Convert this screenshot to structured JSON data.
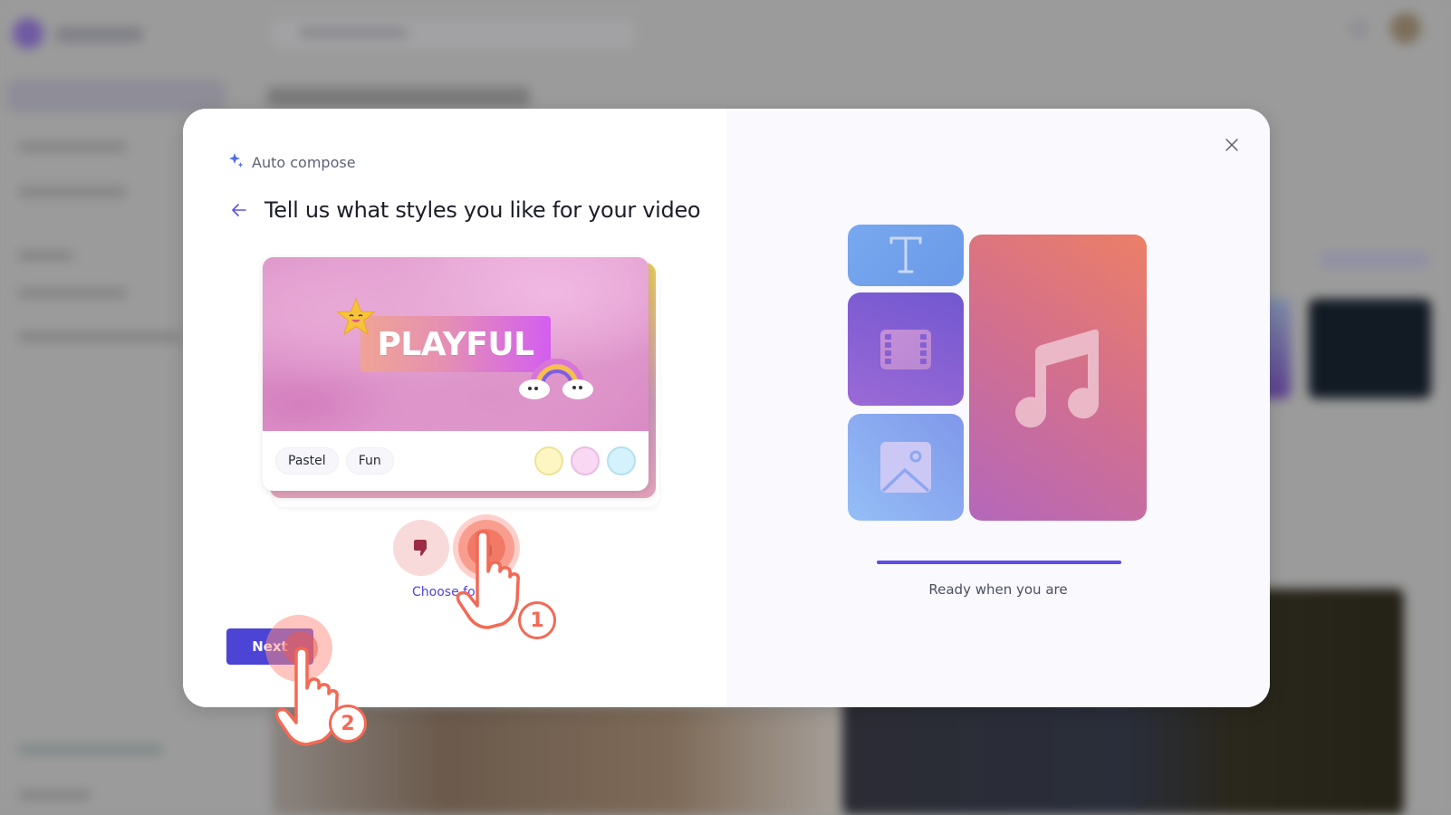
{
  "dialog": {
    "section_label": "Auto compose",
    "title": "Tell us what styles you like for your video",
    "style_card": {
      "name": "PLAYFUL",
      "tags": [
        "Pastel",
        "Fun"
      ],
      "palette": [
        {
          "fill": "#fdf6c2",
          "border": "#ece397"
        },
        {
          "fill": "#f8d8f3",
          "border": "#e9bde3"
        },
        {
          "fill": "#d3f2fb",
          "border": "#b3e1ee"
        }
      ]
    },
    "dislike_label": "Dislike style",
    "like_label": "Like style",
    "choose_label": "Choose fo",
    "next_label": "Next",
    "close_label": "Close",
    "preview": {
      "tiles": [
        "text",
        "video",
        "image",
        "music"
      ],
      "progress": 1.0,
      "status": "Ready when you are"
    }
  },
  "tutorial": {
    "steps": [
      "1",
      "2"
    ]
  },
  "colors": {
    "accent": "#4b44d5",
    "link": "#4f46e5",
    "hand_outline": "#f26a55"
  }
}
